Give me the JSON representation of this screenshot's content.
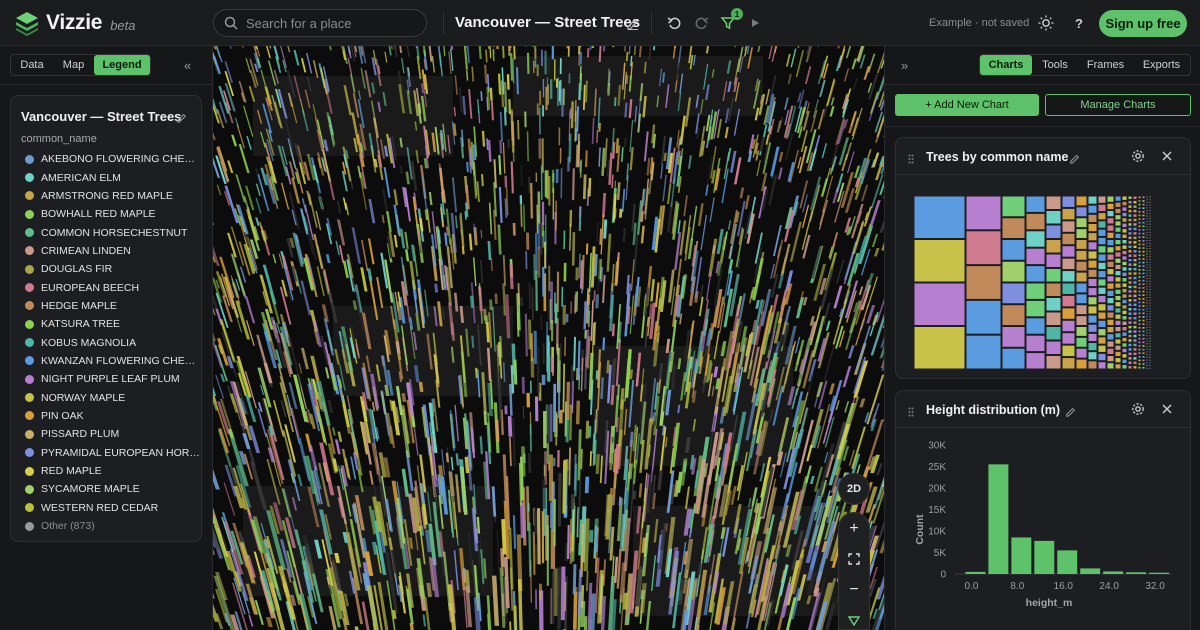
{
  "app": {
    "name": "Vizzie",
    "tag": "beta",
    "doc_title": "Vancouver — Street Trees",
    "status": "Example · not saved",
    "signup_label": "Sign up free",
    "filter_count": "1",
    "accent": "#5ec26a"
  },
  "search": {
    "placeholder": "Search for a place"
  },
  "left_tabs": [
    "Data",
    "Map",
    "Legend"
  ],
  "legend": {
    "title": "Vancouver — Street Trees",
    "field": "common_name",
    "items": [
      {
        "label": "AKEBONO FLOWERING CHE…",
        "color": "#6f9ccf"
      },
      {
        "label": "AMERICAN ELM",
        "color": "#6fd0c6"
      },
      {
        "label": "ARMSTRONG RED MAPLE",
        "color": "#c9a24a"
      },
      {
        "label": "BOWHALL RED MAPLE",
        "color": "#8fd05a"
      },
      {
        "label": "COMMON HORSECHESTNUT",
        "color": "#5fbf8a"
      },
      {
        "label": "CRIMEAN LINDEN",
        "color": "#c99a8a"
      },
      {
        "label": "DOUGLAS FIR",
        "color": "#a9a54a"
      },
      {
        "label": "EUROPEAN BEECH",
        "color": "#d07a8f"
      },
      {
        "label": "HEDGE MAPLE",
        "color": "#c08a5a"
      },
      {
        "label": "KATSURA TREE",
        "color": "#8fcf4a"
      },
      {
        "label": "KOBUS MAGNOLIA",
        "color": "#4fb6a6"
      },
      {
        "label": "KWANZAN FLOWERING CHE…",
        "color": "#5b9be0"
      },
      {
        "label": "NIGHT PURPLE LEAF PLUM",
        "color": "#b67fd0"
      },
      {
        "label": "NORWAY MAPLE",
        "color": "#c9c24a"
      },
      {
        "label": "PIN OAK",
        "color": "#d9a03a"
      },
      {
        "label": "PISSARD PLUM",
        "color": "#c8b06a"
      },
      {
        "label": "PYRAMIDAL EUROPEAN HOR…",
        "color": "#7f8fe0"
      },
      {
        "label": "RED MAPLE",
        "color": "#d9d04a"
      },
      {
        "label": "SYCAMORE MAPLE",
        "color": "#9fd06a"
      },
      {
        "label": "WESTERN RED CEDAR",
        "color": "#b9c23a"
      }
    ],
    "other_label": "Other (873)",
    "other_color": "#9a9a9a"
  },
  "map_controls": {
    "mode_label": "2D"
  },
  "right_tabs": [
    "Charts",
    "Tools",
    "Frames",
    "Exports"
  ],
  "actions": {
    "add_chart": "+ Add New Chart",
    "manage_charts": "Manage Charts"
  },
  "charts": [
    {
      "title": "Trees by common name"
    },
    {
      "title": "Height distribution (m)"
    }
  ],
  "chart_data": {
    "type": "bar",
    "title": "Height distribution (m)",
    "xlabel": "height_m",
    "ylabel": "Count",
    "x_ticks": [
      "0.0",
      "8.0",
      "16.0",
      "24.0",
      "32.0"
    ],
    "y_ticks": [
      "0",
      "5K",
      "10K",
      "15K",
      "20K",
      "25K",
      "30K"
    ],
    "ylim": [
      0,
      30000
    ],
    "xlim": [
      -2,
      36
    ],
    "bin_width": 4,
    "bins": [
      0,
      4,
      8,
      12,
      16,
      20,
      24,
      28,
      32
    ],
    "values": [
      500,
      25500,
      8500,
      7700,
      5500,
      1300,
      600,
      400,
      300
    ],
    "color": "#5ec26a",
    "grid": false
  }
}
